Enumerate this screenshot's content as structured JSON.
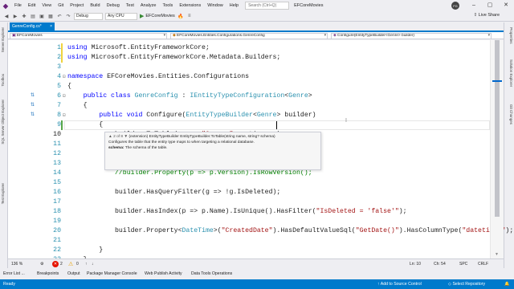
{
  "menu": [
    "File",
    "Edit",
    "View",
    "Git",
    "Project",
    "Build",
    "Debug",
    "Test",
    "Analyze",
    "Tools",
    "Extensions",
    "Window",
    "Help"
  ],
  "search_placeholder": "Search (Ctrl+Q)",
  "solution_title": "EFCoreMovies",
  "avatar_initials": "FG",
  "live_share": "Live Share",
  "toolbar": {
    "config": "Debug",
    "platform": "Any CPU",
    "run_label": "EFCoreMovies"
  },
  "left_tabs": [
    "Server Explorer",
    "Toolbox",
    "SQL Server Object Explorer",
    "Test Explorer"
  ],
  "right_tabs": [
    "Properties",
    "Solution Explorer",
    "Git Changes"
  ],
  "doc_tab": {
    "label": "GenreConfig.cs*",
    "close": "×"
  },
  "navbar": {
    "project": "EFCoreMovies",
    "type": "EFCoreMovies.Entities.Configurations.GenreConfig",
    "member": "Configure(EntityTypeBuilder<Genre> builder)"
  },
  "code_lines": [
    {
      "n": "1",
      "parts": [
        [
          "kw",
          "using "
        ],
        [
          "pl",
          "Microsoft.EntityFrameworkCore;"
        ]
      ]
    },
    {
      "n": "2",
      "parts": [
        [
          "kw",
          "using "
        ],
        [
          "pl",
          "Microsoft.EntityFrameworkCore.Metadata.Builders;"
        ]
      ]
    },
    {
      "n": "3",
      "parts": []
    },
    {
      "n": "4",
      "parts": [
        [
          "kw",
          "namespace "
        ],
        [
          "pl",
          "EFCoreMovies.Entities.Configurations"
        ]
      ]
    },
    {
      "n": "5",
      "parts": [
        [
          "pl",
          "{"
        ]
      ]
    },
    {
      "n": "6",
      "parts": [
        [
          "pl",
          "    "
        ],
        [
          "kw",
          "public class "
        ],
        [
          "ty",
          "GenreConfig"
        ],
        [
          "pl",
          " : "
        ],
        [
          "ty",
          "IEntityTypeConfiguration"
        ],
        [
          "pl",
          "<"
        ],
        [
          "ty",
          "Genre"
        ],
        [
          "pl",
          ">"
        ]
      ]
    },
    {
      "n": "7",
      "parts": [
        [
          "pl",
          "    {"
        ]
      ]
    },
    {
      "n": "8",
      "parts": [
        [
          "pl",
          "        "
        ],
        [
          "kw",
          "public void "
        ],
        [
          "pl",
          "Configure("
        ],
        [
          "ty",
          "EntityTypeBuilder"
        ],
        [
          "pl",
          "<"
        ],
        [
          "ty",
          "Genre"
        ],
        [
          "pl",
          "> builder)"
        ]
      ]
    },
    {
      "n": "9",
      "parts": [
        [
          "pl",
          "        {"
        ]
      ]
    },
    {
      "n": "10",
      "parts": [
        [
          "pl",
          "            builder.ToTable(name: "
        ],
        [
          "st",
          "\"Genres\""
        ],
        [
          "pl",
          ", options =)"
        ]
      ]
    },
    {
      "n": "11",
      "parts": []
    },
    {
      "n": "12",
      "parts": []
    },
    {
      "n": "13",
      "parts": []
    },
    {
      "n": "14",
      "parts": [
        [
          "cm",
          "            //builder.Property(p => p.Version).IsRowVersion();"
        ]
      ]
    },
    {
      "n": "15",
      "parts": []
    },
    {
      "n": "16",
      "parts": [
        [
          "pl",
          "            builder.HasQueryFilter(g => !g.IsDeleted);"
        ]
      ]
    },
    {
      "n": "17",
      "parts": []
    },
    {
      "n": "18",
      "parts": [
        [
          "pl",
          "            builder.HasIndex(p => p.Name).IsUnique().HasFilter("
        ],
        [
          "st",
          "\"IsDeleted = 'false'\""
        ],
        [
          "pl",
          ");"
        ]
      ]
    },
    {
      "n": "19",
      "parts": []
    },
    {
      "n": "20",
      "parts": [
        [
          "pl",
          "            builder.Property<"
        ],
        [
          "ty",
          "DateTime"
        ],
        [
          "pl",
          ">("
        ],
        [
          "st",
          "\"CreatedDate\""
        ],
        [
          "pl",
          ").HasDefaultValueSql("
        ],
        [
          "st",
          "\"GetDate()\""
        ],
        [
          "pl",
          ").HasColumnType("
        ],
        [
          "st",
          "\"datetime2\""
        ],
        [
          "pl",
          ");"
        ]
      ]
    },
    {
      "n": "21",
      "parts": []
    },
    {
      "n": "22",
      "parts": [
        [
          "pl",
          "        }"
        ]
      ]
    },
    {
      "n": "23",
      "parts": [
        [
          "pl",
          "    }"
        ]
      ]
    },
    {
      "n": "24",
      "parts": [
        [
          "pl",
          "}"
        ]
      ]
    },
    {
      "n": "25",
      "parts": []
    }
  ],
  "signature_help": {
    "counter": "▲ 2 of 8 ▼",
    "signature": "(extension) EntityTypeBuilder EntityTypeBuilder.ToTable(string name, string? schema)",
    "summary": "Configures the table that the entity type maps to when targeting a relational database.",
    "param_name": "schema:",
    "param_desc": "The schema of the table."
  },
  "editor_status": {
    "zoom": "136 %",
    "errors": "2",
    "warnings": "0",
    "line": "Ln: 10",
    "col": "Ch: 54",
    "spc": "SPC",
    "eol": "CRLF"
  },
  "tool_tabs": [
    "Error List ...",
    "Breakpoints",
    "Output",
    "Package Manager Console",
    "Web Publish Activity",
    "Data Tools Operations"
  ],
  "statusbar": {
    "ready": "Ready",
    "add_source": "Add to Source Control",
    "select_repo": "Select Repository"
  },
  "colors": {
    "accent": "#007acc",
    "keyword": "#0000ff",
    "type": "#2b91af",
    "string": "#a31515",
    "comment": "#008000"
  }
}
